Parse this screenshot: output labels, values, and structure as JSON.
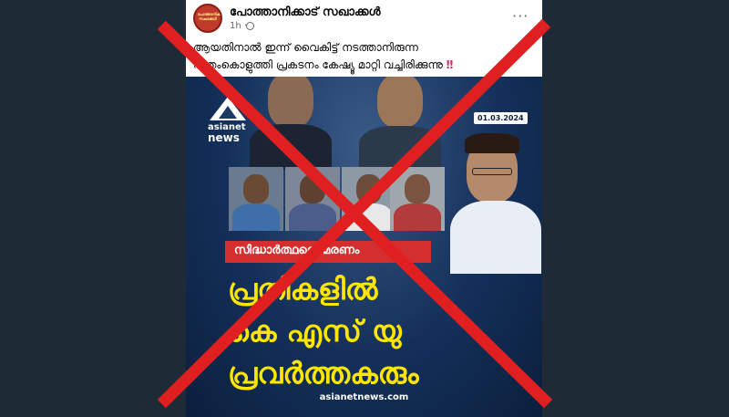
{
  "post": {
    "page_name": "പോത്താനിക്കാട് സഖാക്കൾ",
    "time": "1h ·",
    "more": "···",
    "avatar_text": "പോത്താനിക്കാട് സഖാക്കൾ",
    "text_line1": "ആയതിനാൽ ഇന്ന് വൈകിട്ട് നടത്താനിരുന്ന",
    "text_line2": "പന്തംകൊളുത്തി പ്രകടനം കേഷ്യൂ മാറ്റി വച്ചിരിക്കുന്നു",
    "text_emph": "‼"
  },
  "news_image": {
    "logo_line1": "asianet",
    "logo_line2": "news",
    "date": "01.03.2024",
    "tag": "സിദ്ധാർത്ഥന്റെ മരണം",
    "headline_line1": "പ്രതികളിൽ",
    "headline_line2": "കെ എസ് യു",
    "headline_line3": "പ്രവർത്തകരും",
    "credit": "asianetnews.com"
  },
  "colors": {
    "cross": "#e02020",
    "headline": "#ffe600",
    "tag_bg": "#d32f2f",
    "image_bg": "#0f2a4f"
  }
}
